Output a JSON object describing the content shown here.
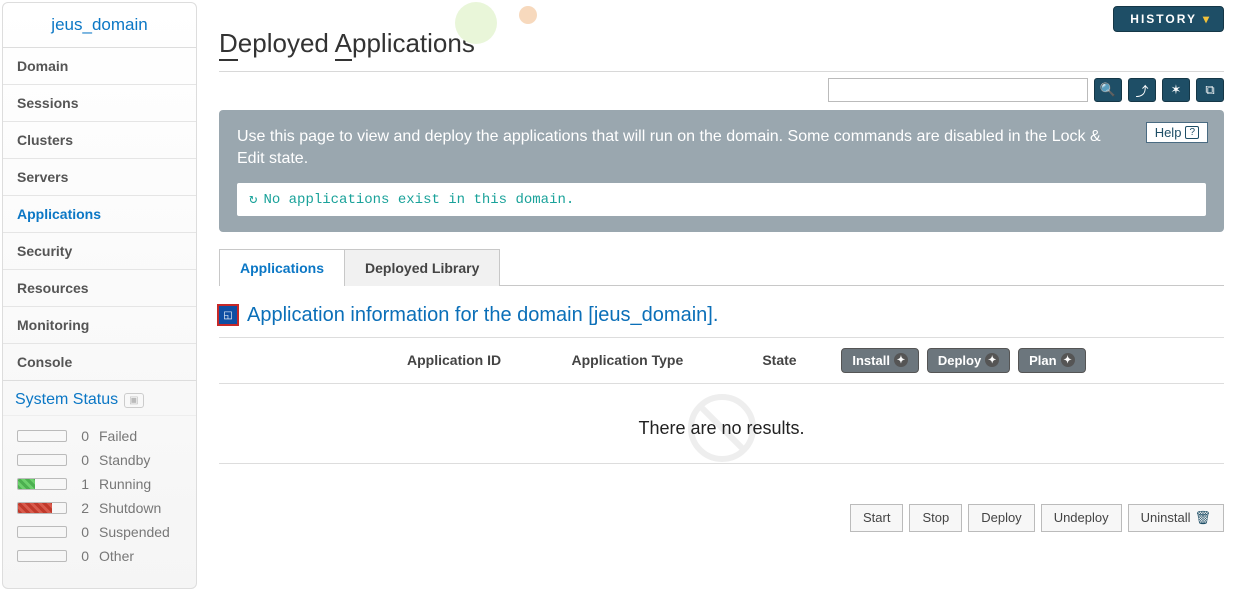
{
  "sidebar": {
    "domain_label": "jeus_domain",
    "items": [
      {
        "label": "Domain"
      },
      {
        "label": "Sessions"
      },
      {
        "label": "Clusters"
      },
      {
        "label": "Servers"
      },
      {
        "label": "Applications",
        "active": true
      },
      {
        "label": "Security"
      },
      {
        "label": "Resources"
      },
      {
        "label": "Monitoring"
      },
      {
        "label": "Console"
      }
    ]
  },
  "system_status": {
    "title": "System Status",
    "rows": [
      {
        "count": "0",
        "label": "Failed",
        "fill": "none"
      },
      {
        "count": "0",
        "label": "Standby",
        "fill": "none"
      },
      {
        "count": "1",
        "label": "Running",
        "fill": "green"
      },
      {
        "count": "2",
        "label": "Shutdown",
        "fill": "red"
      },
      {
        "count": "0",
        "label": "Suspended",
        "fill": "none"
      },
      {
        "count": "0",
        "label": "Other",
        "fill": "none"
      }
    ]
  },
  "header": {
    "history_label": "HISTORY",
    "page_title_underlined_1": "D",
    "page_title_rest_1": "eployed ",
    "page_title_underlined_2": "A",
    "page_title_rest_2": "pplications",
    "search_placeholder": ""
  },
  "info_panel": {
    "description": "Use this page to view and deploy the applications that will run on the domain. Some commands are disabled in the Lock & Edit state.",
    "help_label": "Help",
    "status_message": "No applications exist in this domain."
  },
  "tabs": [
    {
      "label": "Applications",
      "active": true
    },
    {
      "label": "Deployed Library"
    }
  ],
  "section": {
    "title": "Application information for the domain [jeus_domain]."
  },
  "table": {
    "columns": {
      "app_id": "Application ID",
      "app_type": "Application Type",
      "state": "State"
    },
    "buttons": {
      "install": "Install",
      "deploy": "Deploy",
      "plan": "Plan"
    },
    "no_results": "There are no results."
  },
  "bottom_actions": {
    "start": "Start",
    "stop": "Stop",
    "deploy": "Deploy",
    "undeploy": "Undeploy",
    "uninstall": "Uninstall"
  }
}
